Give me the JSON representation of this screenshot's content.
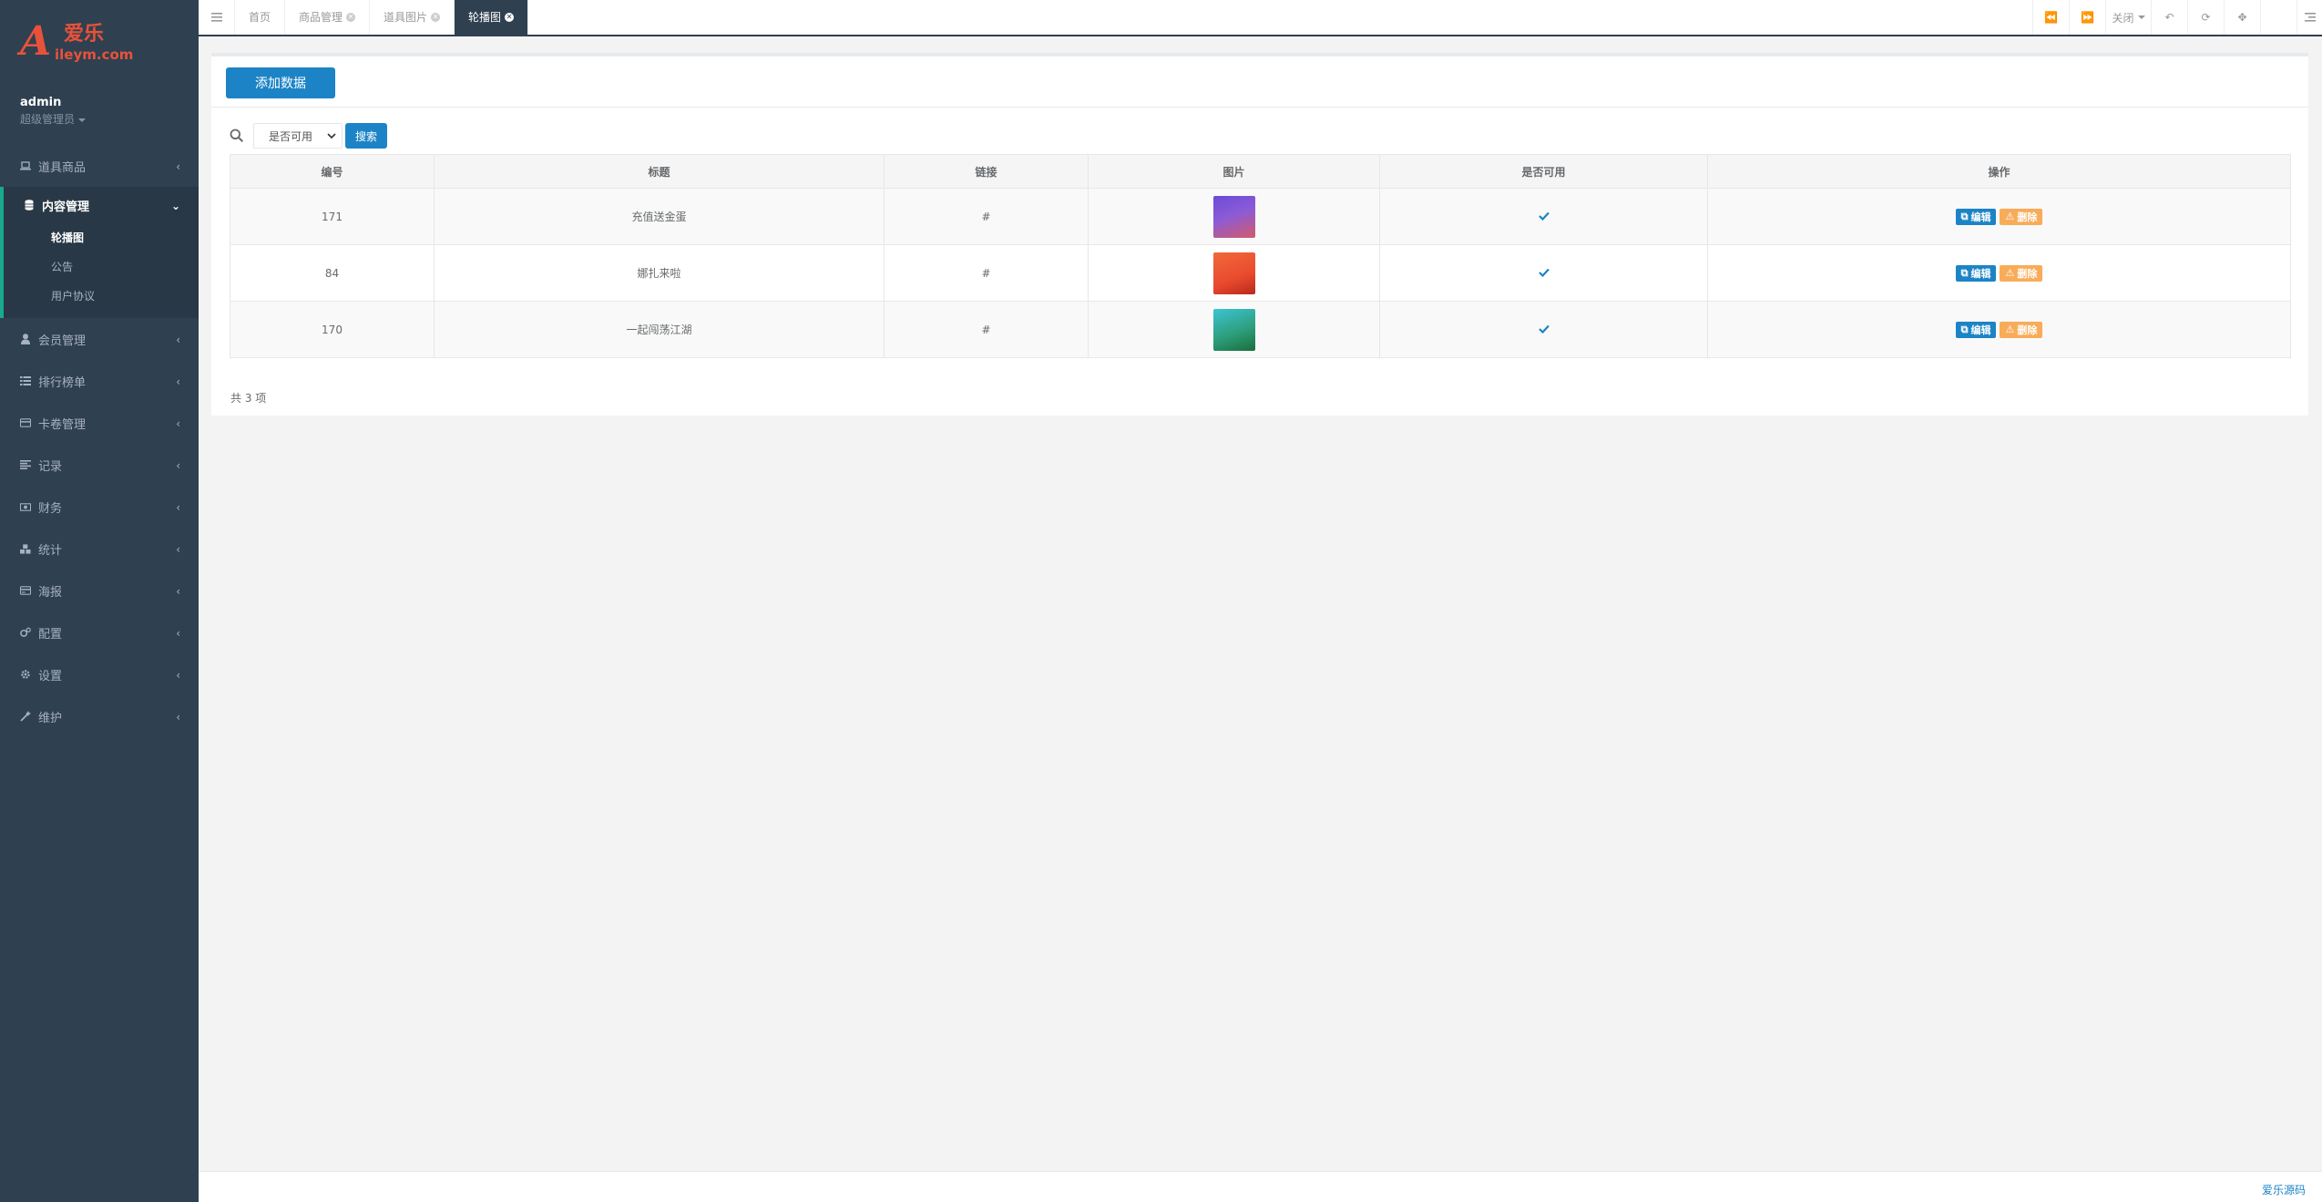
{
  "logo": {
    "initial": "A",
    "text_cn": "爱乐",
    "domain": "ileym.com"
  },
  "profile": {
    "name": "admin",
    "role": "超级管理员"
  },
  "sidebar": {
    "items": [
      {
        "label": "道具商品",
        "icon": "laptop-icon"
      },
      {
        "label": "内容管理",
        "icon": "database-icon",
        "expanded": true,
        "children": [
          {
            "label": "轮播图",
            "current": true
          },
          {
            "label": "公告"
          },
          {
            "label": "用户协议"
          }
        ]
      },
      {
        "label": "会员管理",
        "icon": "user-icon"
      },
      {
        "label": "排行榜单",
        "icon": "list-icon"
      },
      {
        "label": "卡卷管理",
        "icon": "credit-card-icon"
      },
      {
        "label": "记录",
        "icon": "align-left-icon"
      },
      {
        "label": "财务",
        "icon": "money-icon"
      },
      {
        "label": "统计",
        "icon": "cubes-icon"
      },
      {
        "label": "海报",
        "icon": "card-icon"
      },
      {
        "label": "配置",
        "icon": "cogs-icon"
      },
      {
        "label": "设置",
        "icon": "gear-icon"
      },
      {
        "label": "维护",
        "icon": "magic-wand-icon"
      }
    ]
  },
  "tabs": [
    {
      "label": "首页",
      "closable": false,
      "active": false
    },
    {
      "label": "商品管理",
      "closable": true,
      "active": false
    },
    {
      "label": "道具图片",
      "closable": true,
      "active": false
    },
    {
      "label": "轮播图",
      "closable": true,
      "active": true
    }
  ],
  "toolbar": {
    "close_label": "关闭"
  },
  "main": {
    "add_button": "添加数据",
    "filter": {
      "select_value": "是否可用",
      "search_button": "搜索"
    },
    "table": {
      "columns": [
        "编号",
        "标题",
        "链接",
        "图片",
        "是否可用",
        "操作"
      ],
      "rows": [
        {
          "id": "171",
          "title": "充值送金蛋",
          "link": "#",
          "enabled": true
        },
        {
          "id": "84",
          "title": "娜扎来啦",
          "link": "#",
          "enabled": true
        },
        {
          "id": "170",
          "title": "一起闯荡江湖",
          "link": "#",
          "enabled": true
        }
      ],
      "edit_label": "编辑",
      "delete_label": "删除"
    },
    "total_text": "共 3 项"
  },
  "footer": {
    "link_text": "爱乐源码"
  },
  "colors": {
    "sidebar_bg": "#2f4050",
    "primary": "#1c84c6",
    "warning": "#f8ac59",
    "logo": "#e8523a"
  }
}
